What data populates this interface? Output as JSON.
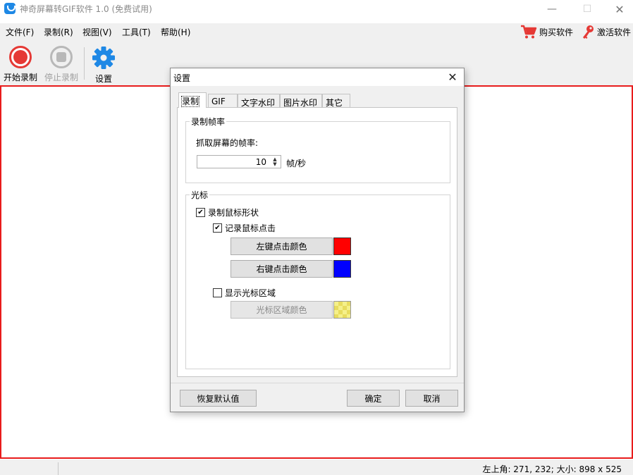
{
  "window": {
    "title": "神奇屏幕转GIF软件 1.0 (免费试用)",
    "minimize": "—",
    "maximize": "☐",
    "close": "✕"
  },
  "menu": {
    "items": [
      "文件(F)",
      "录制(R)",
      "视图(V)",
      "工具(T)",
      "帮助(H)"
    ],
    "buy": "购买软件",
    "activate": "激活软件"
  },
  "toolbar": {
    "start": "开始录制",
    "stop": "停止录制",
    "settings": "设置"
  },
  "status": {
    "text": "左上角: 271, 232; 大小: 898 x 525"
  },
  "dialog": {
    "title": "设置",
    "close": "✕",
    "tabs": [
      "录制",
      "GIF",
      "文字水印",
      "图片水印",
      "其它"
    ],
    "active_tab": "录制",
    "frame_rate": {
      "group_title": "录制帧率",
      "label": "抓取屏幕的帧率:",
      "value": "10",
      "unit": "帧/秒"
    },
    "cursor": {
      "group_title": "光标",
      "record_shape": {
        "label": "录制鼠标形状",
        "checked": true
      },
      "record_click": {
        "label": "记录鼠标点击",
        "checked": true
      },
      "left_click_button": "左键点击颜色",
      "left_click_color": "#ff0000",
      "right_click_button": "右键点击颜色",
      "right_click_color": "#0000ff",
      "show_area": {
        "label": "显示光标区域",
        "checked": false
      },
      "area_color_button": "光标区域颜色",
      "area_color": "#f5f08a"
    },
    "buttons": {
      "restore": "恢复默认值",
      "ok": "确定",
      "cancel": "取消"
    }
  },
  "colors": {
    "capture_border": "#e81c1c",
    "record_red": "#e53935",
    "settings_blue": "#1e88e5"
  }
}
